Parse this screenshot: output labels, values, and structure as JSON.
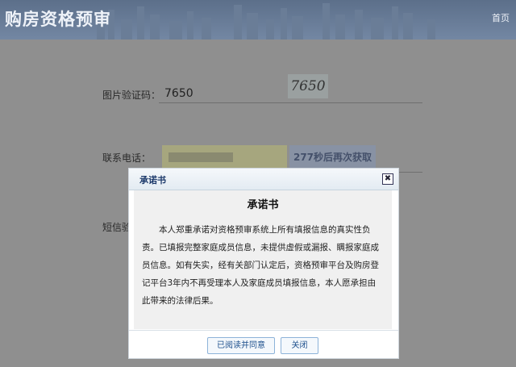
{
  "header": {
    "title": "购房资格预审",
    "home_link": "首页"
  },
  "form": {
    "captcha": {
      "label": "图片验证码：",
      "value": "7650",
      "image_text": "7650"
    },
    "phone": {
      "label": "联系电话：",
      "sms_button": "277秒后再次获取"
    },
    "sms_code": {
      "label": "短信验"
    }
  },
  "modal": {
    "header_title": "承诺书",
    "close_symbol": "✖",
    "doc_title": "承诺书",
    "doc_text": "本人郑重承诺对资格预审系统上所有填报信息的真实性负责。已填报完整家庭成员信息，未提供虚假或漏报、瞒报家庭成员信息。如有失实，经有关部门认定后，资格预审平台及购房登记平台3年内不再受理本人及家庭成员填报信息，本人愿承担由此带来的法律后果。",
    "buttons": {
      "agree": "已阅读并同意",
      "close": "关闭"
    }
  }
}
